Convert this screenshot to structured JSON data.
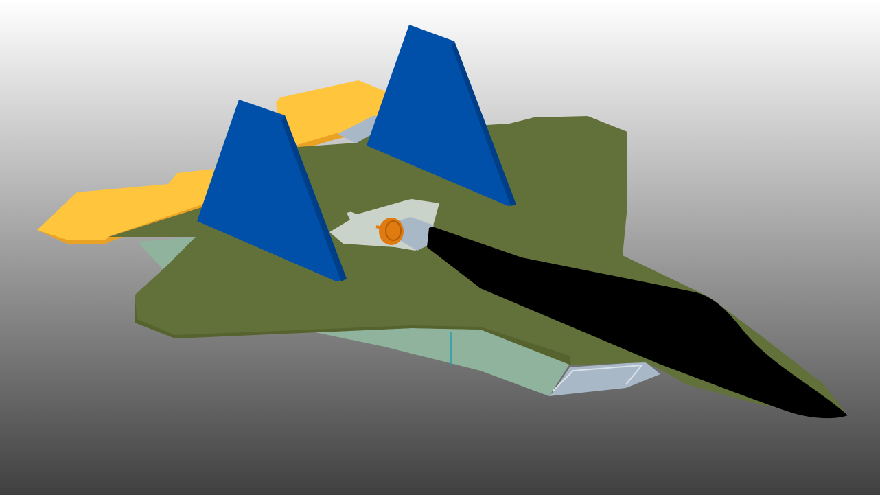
{
  "colors": {
    "bg_top": "#ffffff",
    "bg_bottom": "#404040",
    "fuselage": "#627039",
    "fuselage_shade": "#56632f",
    "canopy": "#000000",
    "tail_fin": "#0050aa",
    "tail_fin_edge": "#003f88",
    "stabilizer": "#ffc53d",
    "stabilizer_edge": "#e9a224",
    "intake": "#8fb39c",
    "intake_line": "#2a9ab0",
    "nozzle": "#a9b8c7",
    "engine_fan": "#e07b12",
    "cutout": "#c9d3c9"
  },
  "model": {
    "icon": "aircraft-model"
  }
}
